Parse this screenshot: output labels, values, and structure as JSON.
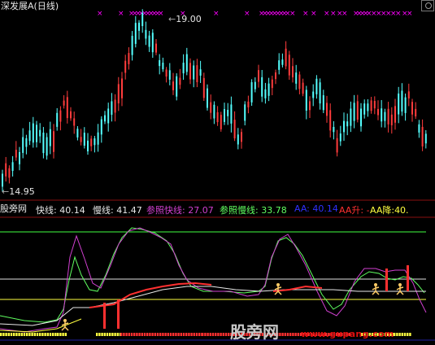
{
  "header": {
    "title": "深发展A",
    "period": "(日线)"
  },
  "price": {
    "high_label": "19.00",
    "low_label": "14.95"
  },
  "indicator": {
    "name": "股旁网",
    "fast_label": "快线:",
    "fast_value": "40.14",
    "slow_label": "慢线:",
    "slow_value": "41.47",
    "ref_fast_label": "参照快线:",
    "ref_fast_value": "27.07",
    "ref_slow_label": "参照慢线:",
    "ref_slow_value": "33.78",
    "aa_label": "AA:",
    "aa_value": "40.14",
    "aa_up_label": "AA升:",
    "aa_up_value": "-",
    "aa_down_label": "AA降:",
    "aa_down_value": "40."
  },
  "watermark": {
    "text": "股旁网",
    "url": "www.gupang.com"
  },
  "colors": {
    "bg": "#000000",
    "up": "#ff3c3c",
    "down": "#54ffff",
    "fast": "#e8e8e8",
    "slow": "#e8e8e8",
    "ref_fast": "#d040d0",
    "ref_slow": "#60ff60",
    "aa": "#3030ff",
    "aa_up": "#ff3030",
    "aa_down": "#ffff40",
    "marker": "#ff00ff"
  }
}
